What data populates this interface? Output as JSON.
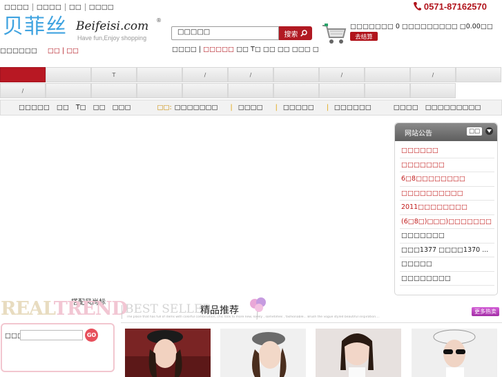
{
  "top_links": [
    "□□□□",
    "□□□□",
    "□□",
    "□□□□"
  ],
  "phone": "0571-87162570",
  "logo": {
    "cn": "贝菲丝",
    "en": "Beifeisi.com",
    "reg": "®",
    "tagline": "Have fun,Enjoy shopping"
  },
  "search": {
    "value": "□□□□□",
    "button": "搜索"
  },
  "hotwords": {
    "prefix": "□□□□ |",
    "hot": "□□□□□",
    "rest": "□□ T□ □□ □□ □□□ □"
  },
  "cart": {
    "line": "□□□□□□□ 0 □□□□□□□□□ □0.00□□",
    "checkout": "去结算"
  },
  "welcome": {
    "text": "□□□□□□",
    "link": "□□ | □□"
  },
  "nav_row1": [
    "",
    "",
    "T",
    "",
    "/",
    "/",
    "",
    "/",
    "",
    "/",
    ""
  ],
  "nav_row2": [
    "/",
    "",
    "",
    "",
    "",
    "",
    "",
    "",
    "",
    ""
  ],
  "subnav": {
    "group1": [
      "□□□□□",
      "□□",
      "T□",
      "□□",
      "□□□"
    ],
    "label": "□□:",
    "group2": [
      "□□□□□□□",
      "□□□□",
      "□□□□□",
      "□□□□□□"
    ],
    "tail": [
      "□□□□",
      "□□□□□□□□□"
    ]
  },
  "notice": {
    "title": "网站公告",
    "more": "□□",
    "items": [
      {
        "text": "□□□□□□",
        "red": true
      },
      {
        "text": "□□□□□□□",
        "red": true
      },
      {
        "text": "6□8□□□□□□□□",
        "red": true
      },
      {
        "text": "□□□□□□□□□□",
        "red": true
      },
      {
        "text": "2011□□□□□□□□",
        "red": true
      },
      {
        "text": "(6□8□)□□□)□□□□□□□",
        "red": true
      },
      {
        "text": "□□□□□□□",
        "red": false
      },
      {
        "text": "□□□1377 □□□□1370 ...",
        "red": false
      },
      {
        "text": "□□□□□",
        "red": false
      },
      {
        "text": "□□□□□□□□",
        "red": false
      }
    ]
  },
  "realtrend": {
    "label": "搭配风尚标",
    "logo_a": "REAL",
    "logo_b": "TREND"
  },
  "bestseller": {
    "en": "BEST SELLER",
    "cn": "精品推荐",
    "tiny": "The place that has full of items with colorful combination, chic look to more new, lovely , sometimes , fashionable... Brush the vogue styled beautiful inspiration....",
    "more": "更多热卖"
  },
  "side_search": {
    "label": "□□□",
    "go": "GO"
  },
  "colors": {
    "brand_red": "#b1141c",
    "logo_blue": "#3fa3e0",
    "nav_active": "#b81823"
  }
}
